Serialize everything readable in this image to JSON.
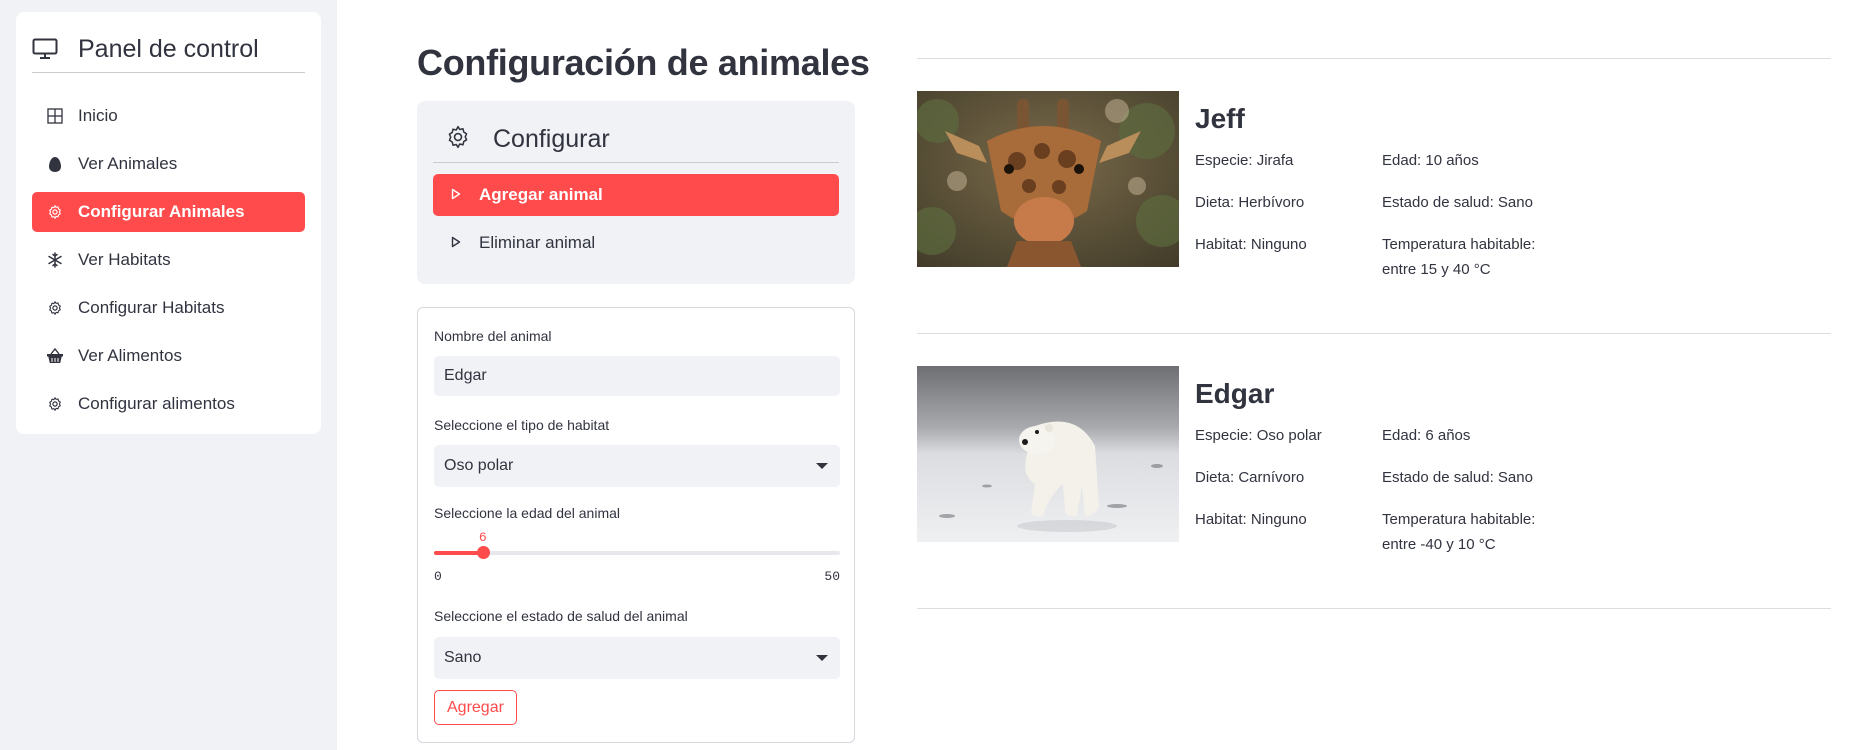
{
  "sidebar": {
    "title": "Panel de control",
    "items": [
      {
        "label": "Inicio",
        "icon": "grid-icon"
      },
      {
        "label": "Ver Animales",
        "icon": "egg-icon"
      },
      {
        "label": "Configurar Animales",
        "icon": "gear-icon"
      },
      {
        "label": "Ver Habitats",
        "icon": "snowflake-icon"
      },
      {
        "label": "Configurar Habitats",
        "icon": "gear-icon"
      },
      {
        "label": "Ver Alimentos",
        "icon": "basket-icon"
      },
      {
        "label": "Configurar alimentos",
        "icon": "gear-icon"
      }
    ],
    "active_index": 2
  },
  "main": {
    "title": "Configuración de animales",
    "config_card": {
      "title": "Configurar",
      "options": [
        "Agregar animal",
        "Eliminar animal"
      ],
      "active_option": 0
    },
    "form": {
      "name_label": "Nombre del animal",
      "name_value": "Edgar",
      "habitat_label": "Seleccione el tipo de habitat",
      "habitat_value": "Oso polar",
      "age_label": "Seleccione la edad del animal",
      "age_value": "6",
      "age_min": "0",
      "age_max": "50",
      "health_label": "Seleccione el estado de salud del animal",
      "health_value": "Sano",
      "submit_label": "Agregar"
    }
  },
  "animals": [
    {
      "name": "Jeff",
      "especie": "Especie: Jirafa",
      "edad": "Edad: 10 años",
      "dieta": "Dieta: Herbívoro",
      "salud": "Estado de salud: Sano",
      "habitat": "Habitat: Ninguno",
      "temperatura": "Temperatura habitable:",
      "temperatura_rango": "entre 15 y 40 °C"
    },
    {
      "name": "Edgar",
      "especie": "Especie: Oso polar",
      "edad": "Edad: 6 años",
      "dieta": "Dieta: Carnívoro",
      "salud": "Estado de salud: Sano",
      "habitat": "Habitat: Ninguno",
      "temperatura": "Temperatura habitable:",
      "temperatura_rango": "entre -40 y 10 °C"
    }
  ],
  "colors": {
    "accent": "#ff4b4b",
    "sidebar_bg": "#f0f2f6",
    "text": "#31333f"
  }
}
